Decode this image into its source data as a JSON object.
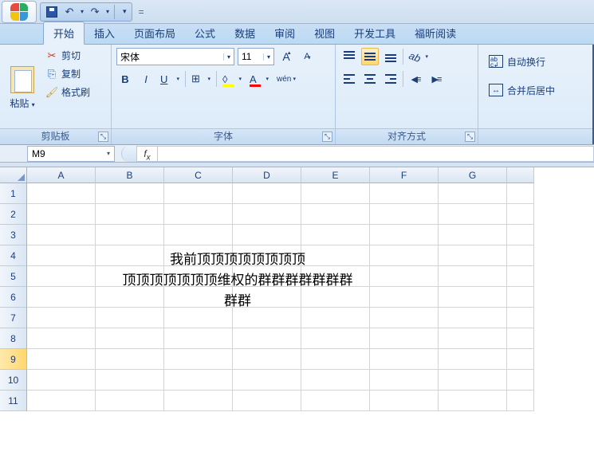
{
  "qat": {
    "caret": "▾"
  },
  "tabs": [
    "开始",
    "插入",
    "页面布局",
    "公式",
    "数据",
    "审阅",
    "视图",
    "开发工具",
    "福昕阅读"
  ],
  "clipboard": {
    "paste": "粘贴",
    "cut": "剪切",
    "copy": "复制",
    "format_painter": "格式刷",
    "group": "剪贴板"
  },
  "font": {
    "name": "宋体",
    "size": "11",
    "group": "字体"
  },
  "align": {
    "group": "对齐方式"
  },
  "wrap": {
    "wrap_text": "自动换行",
    "merge_center": "合并后居中"
  },
  "namebox": "M9",
  "columns": [
    "A",
    "B",
    "C",
    "D",
    "E",
    "F",
    "G"
  ],
  "rows": [
    "1",
    "2",
    "3",
    "4",
    "5",
    "6",
    "7",
    "8",
    "9",
    "10",
    "11"
  ],
  "selected_row": "9",
  "cell_text": {
    "line1": "我前顶顶顶顶顶顶顶顶",
    "line2": "顶顶顶顶顶顶顶维权的群群群群群群群",
    "line3": "群群"
  }
}
